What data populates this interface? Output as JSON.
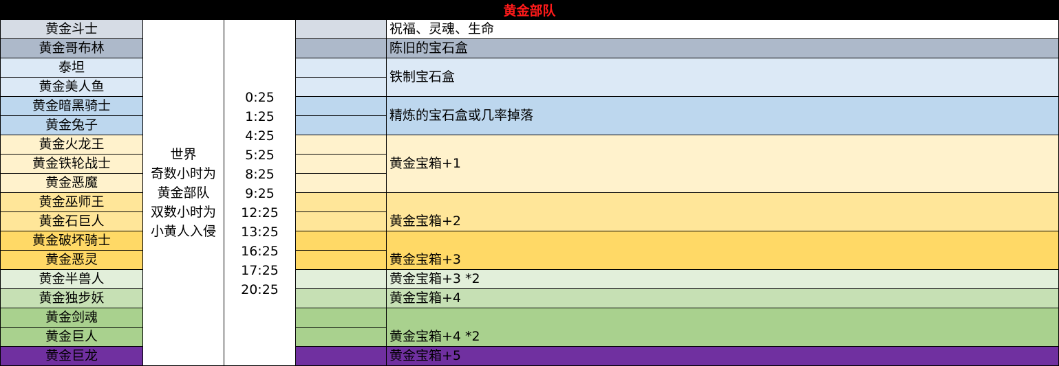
{
  "title": "黄金部队",
  "colors": {
    "header_bg": "#000000",
    "title_red": "#ff1a1a",
    "gray_light": "#d6dce5",
    "gray_dark": "#adb9ca",
    "blue_light": "#dce9f6",
    "blue_mid": "#bdd7ee",
    "yellow_light": "#fff2cc",
    "yellow_mid": "#ffe699",
    "yellow_dark": "#ffd966",
    "green_light": "#e2efda",
    "green_mid": "#c6e0b4",
    "green_dark": "#a9d18e",
    "purple": "#7030a0"
  },
  "monsters": [
    "黄金斗士",
    "黄金哥布林",
    "泰坦",
    "黄金美人鱼",
    "黄金暗黑骑士",
    "黄金兔子",
    "黄金火龙王",
    "黄金铁轮战士",
    "黄金恶魔",
    "黄金巫师王",
    "黄金石巨人",
    "黄金破坏骑士",
    "黄金恶灵",
    "黄金半兽人",
    "黄金独步妖",
    "黄金剑魂",
    "黄金巨人",
    "黄金巨龙"
  ],
  "world": {
    "line1": "世界",
    "line2": "奇数小时为",
    "line3": "黄金部队",
    "line4": "双数小时为",
    "line5": "小黄人入侵"
  },
  "times": [
    "0:25",
    "1:25",
    "4:25",
    "5:25",
    "8:25",
    "9:25",
    "12:25",
    "13:25",
    "16:25",
    "17:25",
    "20:25"
  ],
  "rewards": [
    "祝福、灵魂、生命",
    "陈旧的宝石盒",
    "铁制宝石盒",
    "精炼的宝石盒或几率掉落",
    "黄金宝箱+1",
    "黄金宝箱+2",
    "黄金宝箱+3",
    "黄金宝箱+3 *2",
    "黄金宝箱+4",
    "黄金宝箱+4 *2",
    "黄金宝箱+5"
  ]
}
